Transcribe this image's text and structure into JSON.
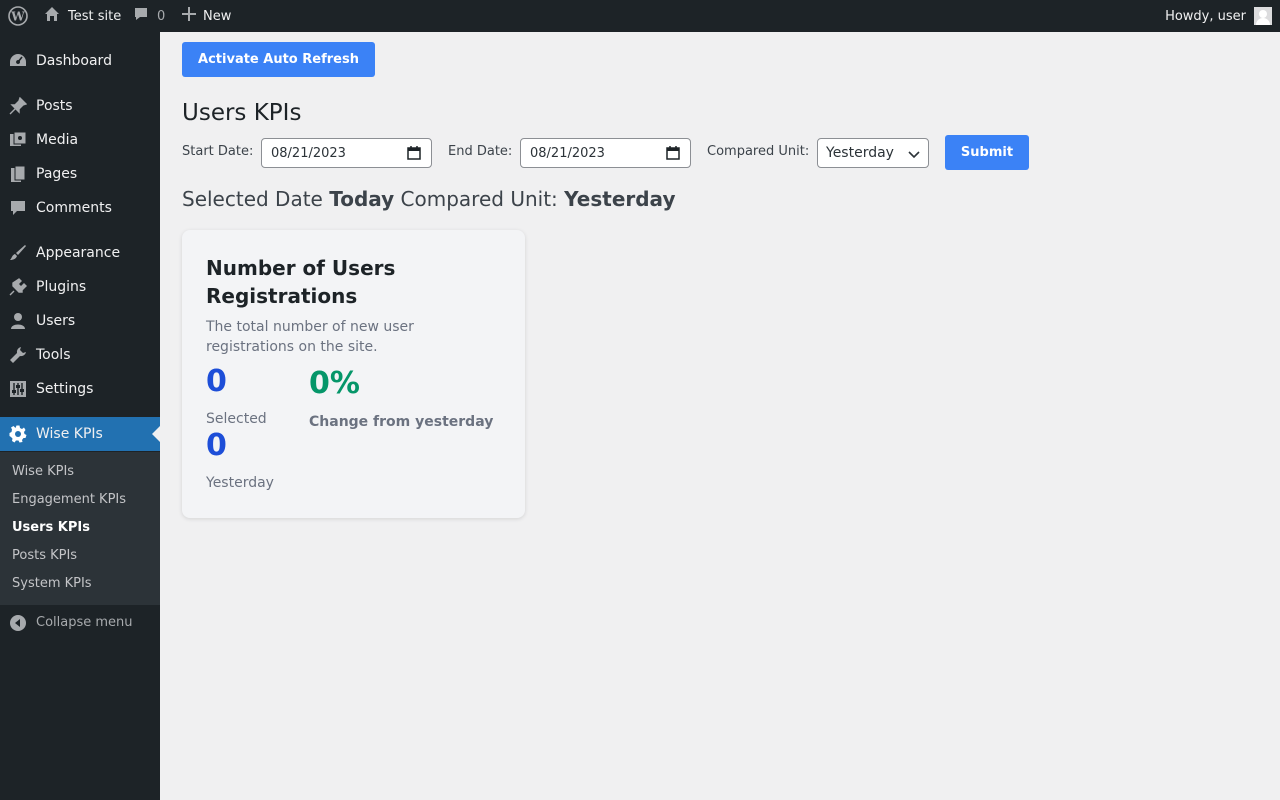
{
  "adminbar": {
    "site_name": "Test site",
    "comments_count": "0",
    "new_label": "New",
    "howdy": "Howdy, user"
  },
  "sidebar": {
    "items": [
      {
        "label": "Dashboard",
        "icon": "dashboard-icon"
      },
      {
        "label": "Posts",
        "icon": "pin-icon"
      },
      {
        "label": "Media",
        "icon": "media-icon"
      },
      {
        "label": "Pages",
        "icon": "pages-icon"
      },
      {
        "label": "Comments",
        "icon": "comment-icon"
      },
      {
        "label": "Appearance",
        "icon": "brush-icon"
      },
      {
        "label": "Plugins",
        "icon": "plug-icon"
      },
      {
        "label": "Users",
        "icon": "user-icon"
      },
      {
        "label": "Tools",
        "icon": "wrench-icon"
      },
      {
        "label": "Settings",
        "icon": "sliders-icon"
      },
      {
        "label": "Wise KPIs",
        "icon": "gear-icon"
      }
    ],
    "submenu": [
      "Wise KPIs",
      "Engagement KPIs",
      "Users KPIs",
      "Posts KPIs",
      "System KPIs"
    ],
    "collapse_label": "Collapse menu"
  },
  "main": {
    "refresh_button": "Activate Auto Refresh",
    "title": "Users KPIs",
    "start_label": "Start Date:",
    "start_value": "08/21/2023",
    "end_label": "End Date:",
    "end_value": "08/21/2023",
    "compared_label": "Compared Unit:",
    "compared_value": "Yesterday",
    "submit_label": "Submit",
    "selected_prefix": "Selected Date",
    "selected_date": "Today",
    "compared_prefix": "Compared Unit:",
    "compared_unit": "Yesterday"
  },
  "card": {
    "title": "Number of Users Registrations",
    "description": "The total number of new user registrations on the site.",
    "selected_value": "0",
    "selected_label": "Selected",
    "yesterday_value": "0",
    "yesterday_label": "Yesterday",
    "change_value": "0%",
    "change_label": "Change from yesterday"
  },
  "colors": {
    "accent": "#2271b1",
    "button": "#3b82f6",
    "number": "#1d4ed8",
    "change": "#059669"
  }
}
